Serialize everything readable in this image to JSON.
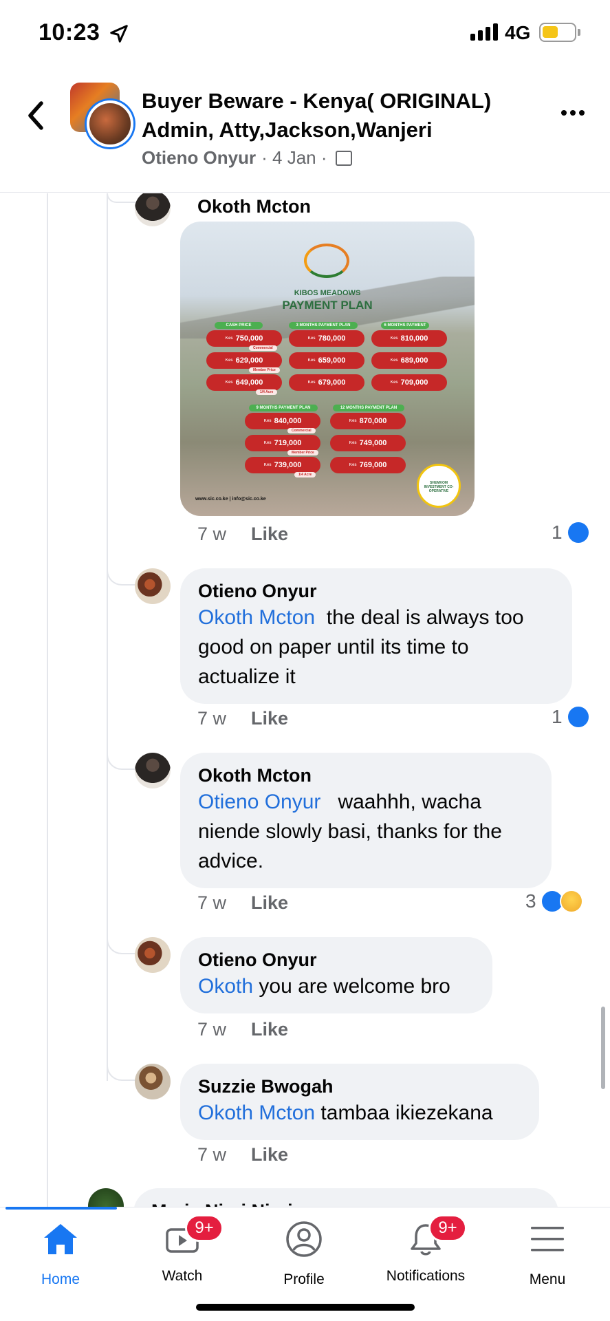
{
  "status_bar": {
    "time": "10:23",
    "network": "4G",
    "battery_level": 0.5,
    "battery_color": "#f5c518"
  },
  "header": {
    "title": "Buyer Beware - Kenya( ORIGINAL) Admin, Atty,Jackson,Wanjeri",
    "poster": "Otieno Onyur",
    "date": "· 4 Jan ·",
    "privacy_icon": "photo-icon"
  },
  "post_image": {
    "brand": "KIBOS MEADOWS",
    "title": "PAYMENT PLAN",
    "currency": "Kes",
    "footer": "www.sic.co.ke | info@sic.co.ke",
    "seal_text": "SHEMKOM INVESTMENT CO-OPERATIVE",
    "column_heads": [
      "CASH PRICE",
      "3 MONTHS PAYMENT PLAN",
      "6 MONTHS PAYMENT PLAN",
      "9 MONTHS PAYMENT PLAN",
      "12 MONTHS PAYMENT PLAN"
    ],
    "top_rows": [
      {
        "values": [
          "750,000",
          "780,000",
          "810,000"
        ],
        "tag": "Commercial"
      },
      {
        "values": [
          "629,000",
          "659,000",
          "689,000"
        ],
        "tag": "Member Price"
      },
      {
        "values": [
          "649,000",
          "679,000",
          "709,000"
        ],
        "tag": "1/4 Acre"
      }
    ],
    "bottom_rows": [
      {
        "values": [
          "840,000",
          "870,000"
        ],
        "tag": "Commercial"
      },
      {
        "values": [
          "719,000",
          "749,000"
        ],
        "tag": "Member Price"
      },
      {
        "values": [
          "739,000",
          "769,000"
        ],
        "tag": "1/4 Acre"
      }
    ]
  },
  "comments": [
    {
      "author": "Okoth Mcton",
      "has_image": true,
      "time": "7 w",
      "like_label": "Like",
      "reaction_count": "1",
      "reactions": [
        "like"
      ]
    },
    {
      "author": "Otieno Onyur",
      "mention": "Okoth Mcton",
      "text": "the deal is always too good on paper until its time to actualize it",
      "time": "7 w",
      "like_label": "Like",
      "reaction_count": "1",
      "reactions": [
        "like"
      ]
    },
    {
      "author": "Okoth Mcton",
      "mention": "Otieno Onyur",
      "text": "waahhh, wacha niende slowly basi, thanks for the advice.",
      "time": "7 w",
      "like_label": "Like",
      "reaction_count": "3",
      "reactions": [
        "like",
        "sad"
      ]
    },
    {
      "author": "Otieno Onyur",
      "mention": "Okoth",
      "text": "you are welcome bro",
      "time": "7 w",
      "like_label": "Like"
    },
    {
      "author": "Suzzie Bwogah",
      "mention": "Okoth Mcton",
      "text": "tambaa ikiezekana",
      "time": "7 w",
      "like_label": "Like"
    }
  ],
  "partial_comment": {
    "author": "Maria Njeri Njeri"
  },
  "bottom_nav": {
    "items": [
      {
        "label": "Home",
        "icon": "home-icon",
        "active": true
      },
      {
        "label": "Watch",
        "icon": "watch-icon",
        "badge": "9+"
      },
      {
        "label": "Profile",
        "icon": "profile-icon"
      },
      {
        "label": "Notifications",
        "icon": "bell-icon",
        "badge": "9+"
      },
      {
        "label": "Menu",
        "icon": "menu-icon"
      }
    ]
  },
  "colors": {
    "brand_blue": "#1877f2",
    "mention_blue": "#216fdb",
    "bubble_bg": "#f0f2f5",
    "badge_red": "#e41e3f",
    "muted_text": "#65676b"
  }
}
